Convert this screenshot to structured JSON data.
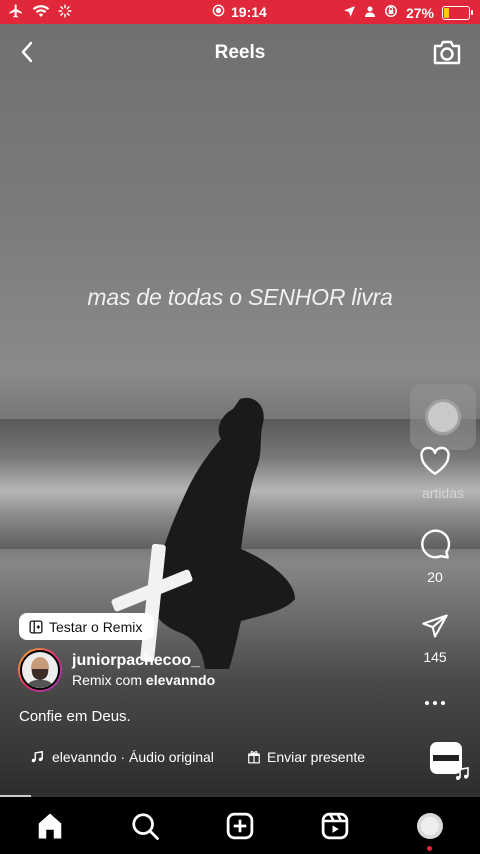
{
  "status_bar": {
    "time": "19:14",
    "battery": "27%",
    "battery_level": 0.27
  },
  "header": {
    "title": "Reels"
  },
  "video": {
    "caption_overlay": "mas de todas o SENHOR livra"
  },
  "actions": {
    "likes_label": "artidas",
    "comments_count": "20",
    "shares_count": "145"
  },
  "remix_button": {
    "label": "Testar o Remix"
  },
  "post": {
    "username": "juniorpachecoo_",
    "remix_prefix": "Remix com",
    "remix_user": "elevanndo",
    "description": "Confie em Deus."
  },
  "audio": {
    "label": "elevanndo · Áudio original"
  },
  "gift": {
    "label": "Enviar presente"
  },
  "playback": {
    "progress": 0.065
  },
  "tabs": [
    "home",
    "search",
    "create",
    "reels",
    "profile"
  ]
}
